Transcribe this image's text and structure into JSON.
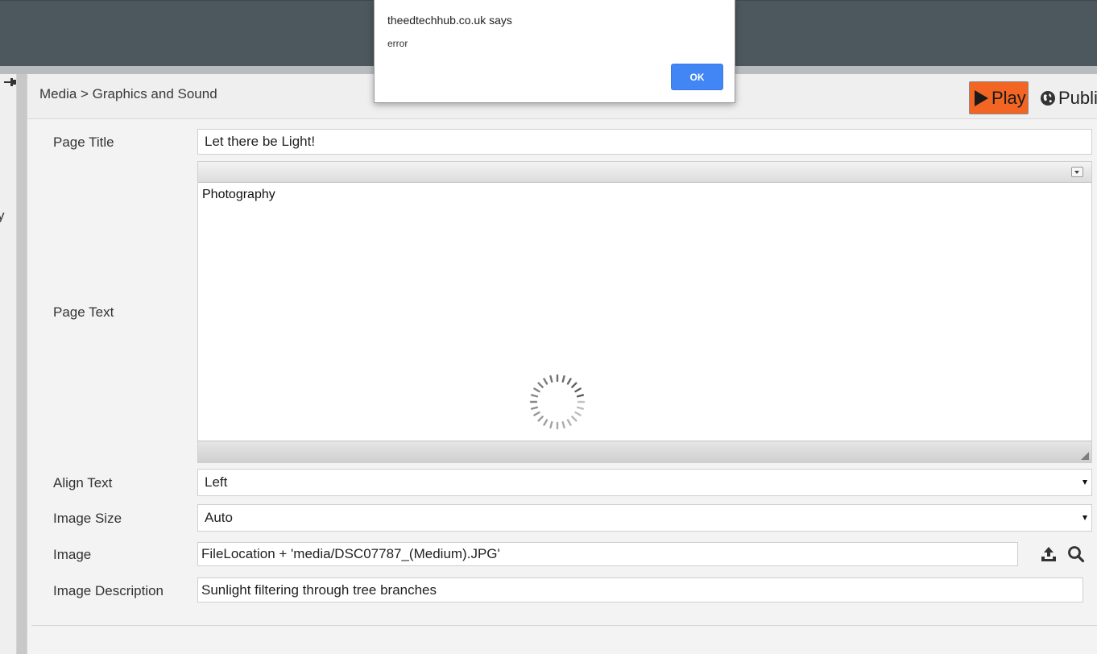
{
  "breadcrumb": "Media > Graphics and Sound",
  "header": {
    "play_label": "Play",
    "publish_label": "Publi"
  },
  "sidebar": {
    "fragment": "y"
  },
  "form": {
    "page_title_label": "Page Title",
    "page_title_value": "Let there be Light!",
    "page_text_label": "Page Text",
    "page_text_value": "Photography",
    "align_text_label": "Align Text",
    "align_text_value": "Left",
    "image_size_label": "Image Size",
    "image_size_value": "Auto",
    "image_label": "Image",
    "image_value": "FileLocation + 'media/DSC07787_(Medium).JPG'",
    "image_description_label": "Image Description",
    "image_description_value": "Sunlight filtering through tree branches"
  },
  "dialog": {
    "title": "theedtechhub.co.uk says",
    "message": "error",
    "ok_label": "OK"
  },
  "colors": {
    "topbar": "#4d585e",
    "play": "#f26522",
    "ok_button": "#4285f4"
  },
  "icons": [
    "pin-icon",
    "play-icon",
    "globe-icon",
    "upload-icon",
    "search-icon",
    "loading-spinner-icon",
    "dropdown-toggle-icon",
    "resize-grip-icon"
  ]
}
